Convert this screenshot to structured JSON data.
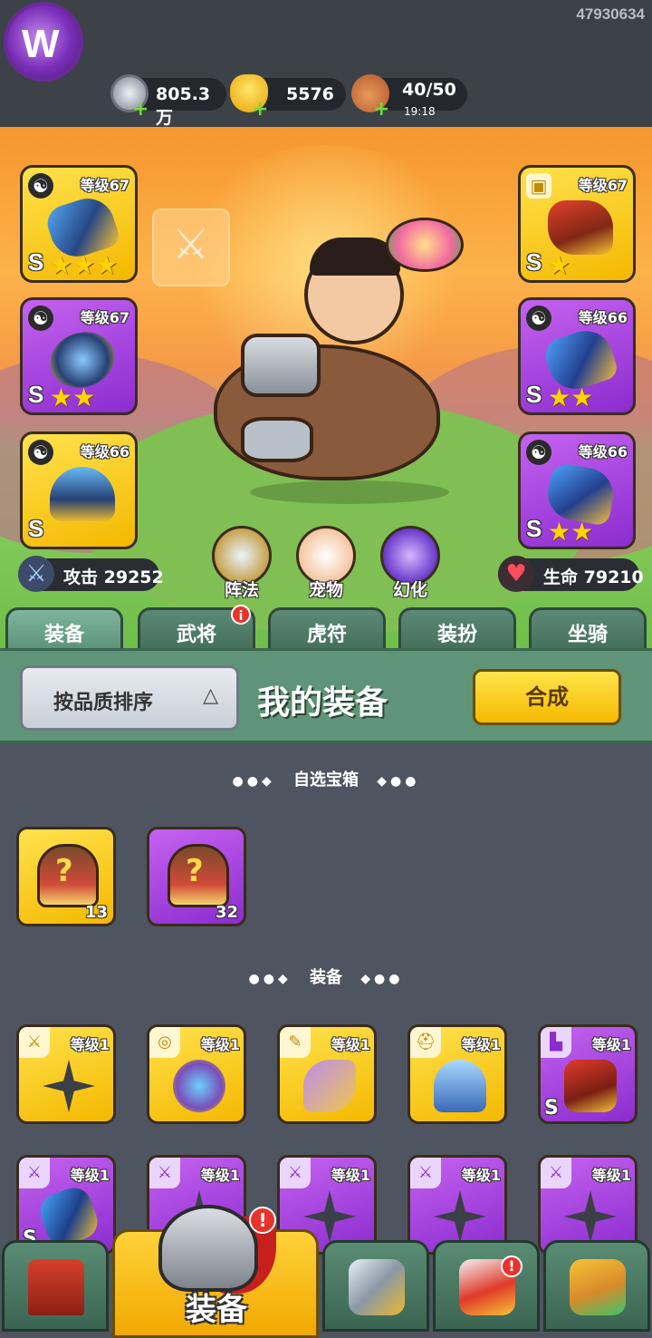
{
  "top": {
    "uid": "47930634",
    "silver": "805.3万",
    "gold": "5576",
    "stamina": "40/50",
    "stamina_timer": "19:18",
    "plus": "+"
  },
  "slots": {
    "l1": {
      "level": "等级67",
      "rank": "S",
      "stars": "★★★"
    },
    "l2": {
      "level": "等级67",
      "rank": "S",
      "stars": "★★"
    },
    "l3": {
      "level": "等级66",
      "rank": "S",
      "stars": ""
    },
    "r1": {
      "level": "等级67",
      "rank": "S",
      "stars": "★"
    },
    "r2": {
      "level": "等级66",
      "rank": "S",
      "stars": "★★"
    },
    "r3": {
      "level": "等级66",
      "rank": "S",
      "stars": "★★"
    }
  },
  "stats": {
    "attack_label": "攻击",
    "attack": "29252",
    "hp_label": "生命",
    "hp": "79210"
  },
  "features": {
    "formation": "阵法",
    "pet": "宠物",
    "illusion": "幻化"
  },
  "tabs": [
    "装备",
    "武将",
    "虎符",
    "装扮",
    "坐骑"
  ],
  "tab_badge": "i",
  "panel": {
    "sort": "按品质排序",
    "title": "我的装备",
    "merge": "合成"
  },
  "sections": {
    "chests": "自选宝箱",
    "equipment": "装备"
  },
  "chests": [
    {
      "count": "13"
    },
    {
      "count": "32"
    }
  ],
  "equip_row1": [
    {
      "level": "等级1",
      "rank": ""
    },
    {
      "level": "等级1",
      "rank": ""
    },
    {
      "level": "等级1",
      "rank": ""
    },
    {
      "level": "等级1",
      "rank": ""
    },
    {
      "level": "等级1",
      "rank": "S"
    }
  ],
  "equip_row2": [
    {
      "level": "等级1",
      "rank": "S"
    },
    {
      "level": "等级1",
      "rank": ""
    },
    {
      "level": "等级1",
      "rank": ""
    },
    {
      "level": "等级1",
      "rank": ""
    },
    {
      "level": "等级1",
      "rank": ""
    }
  ],
  "bottomnav": {
    "active_label": "装备",
    "alert": "!"
  }
}
